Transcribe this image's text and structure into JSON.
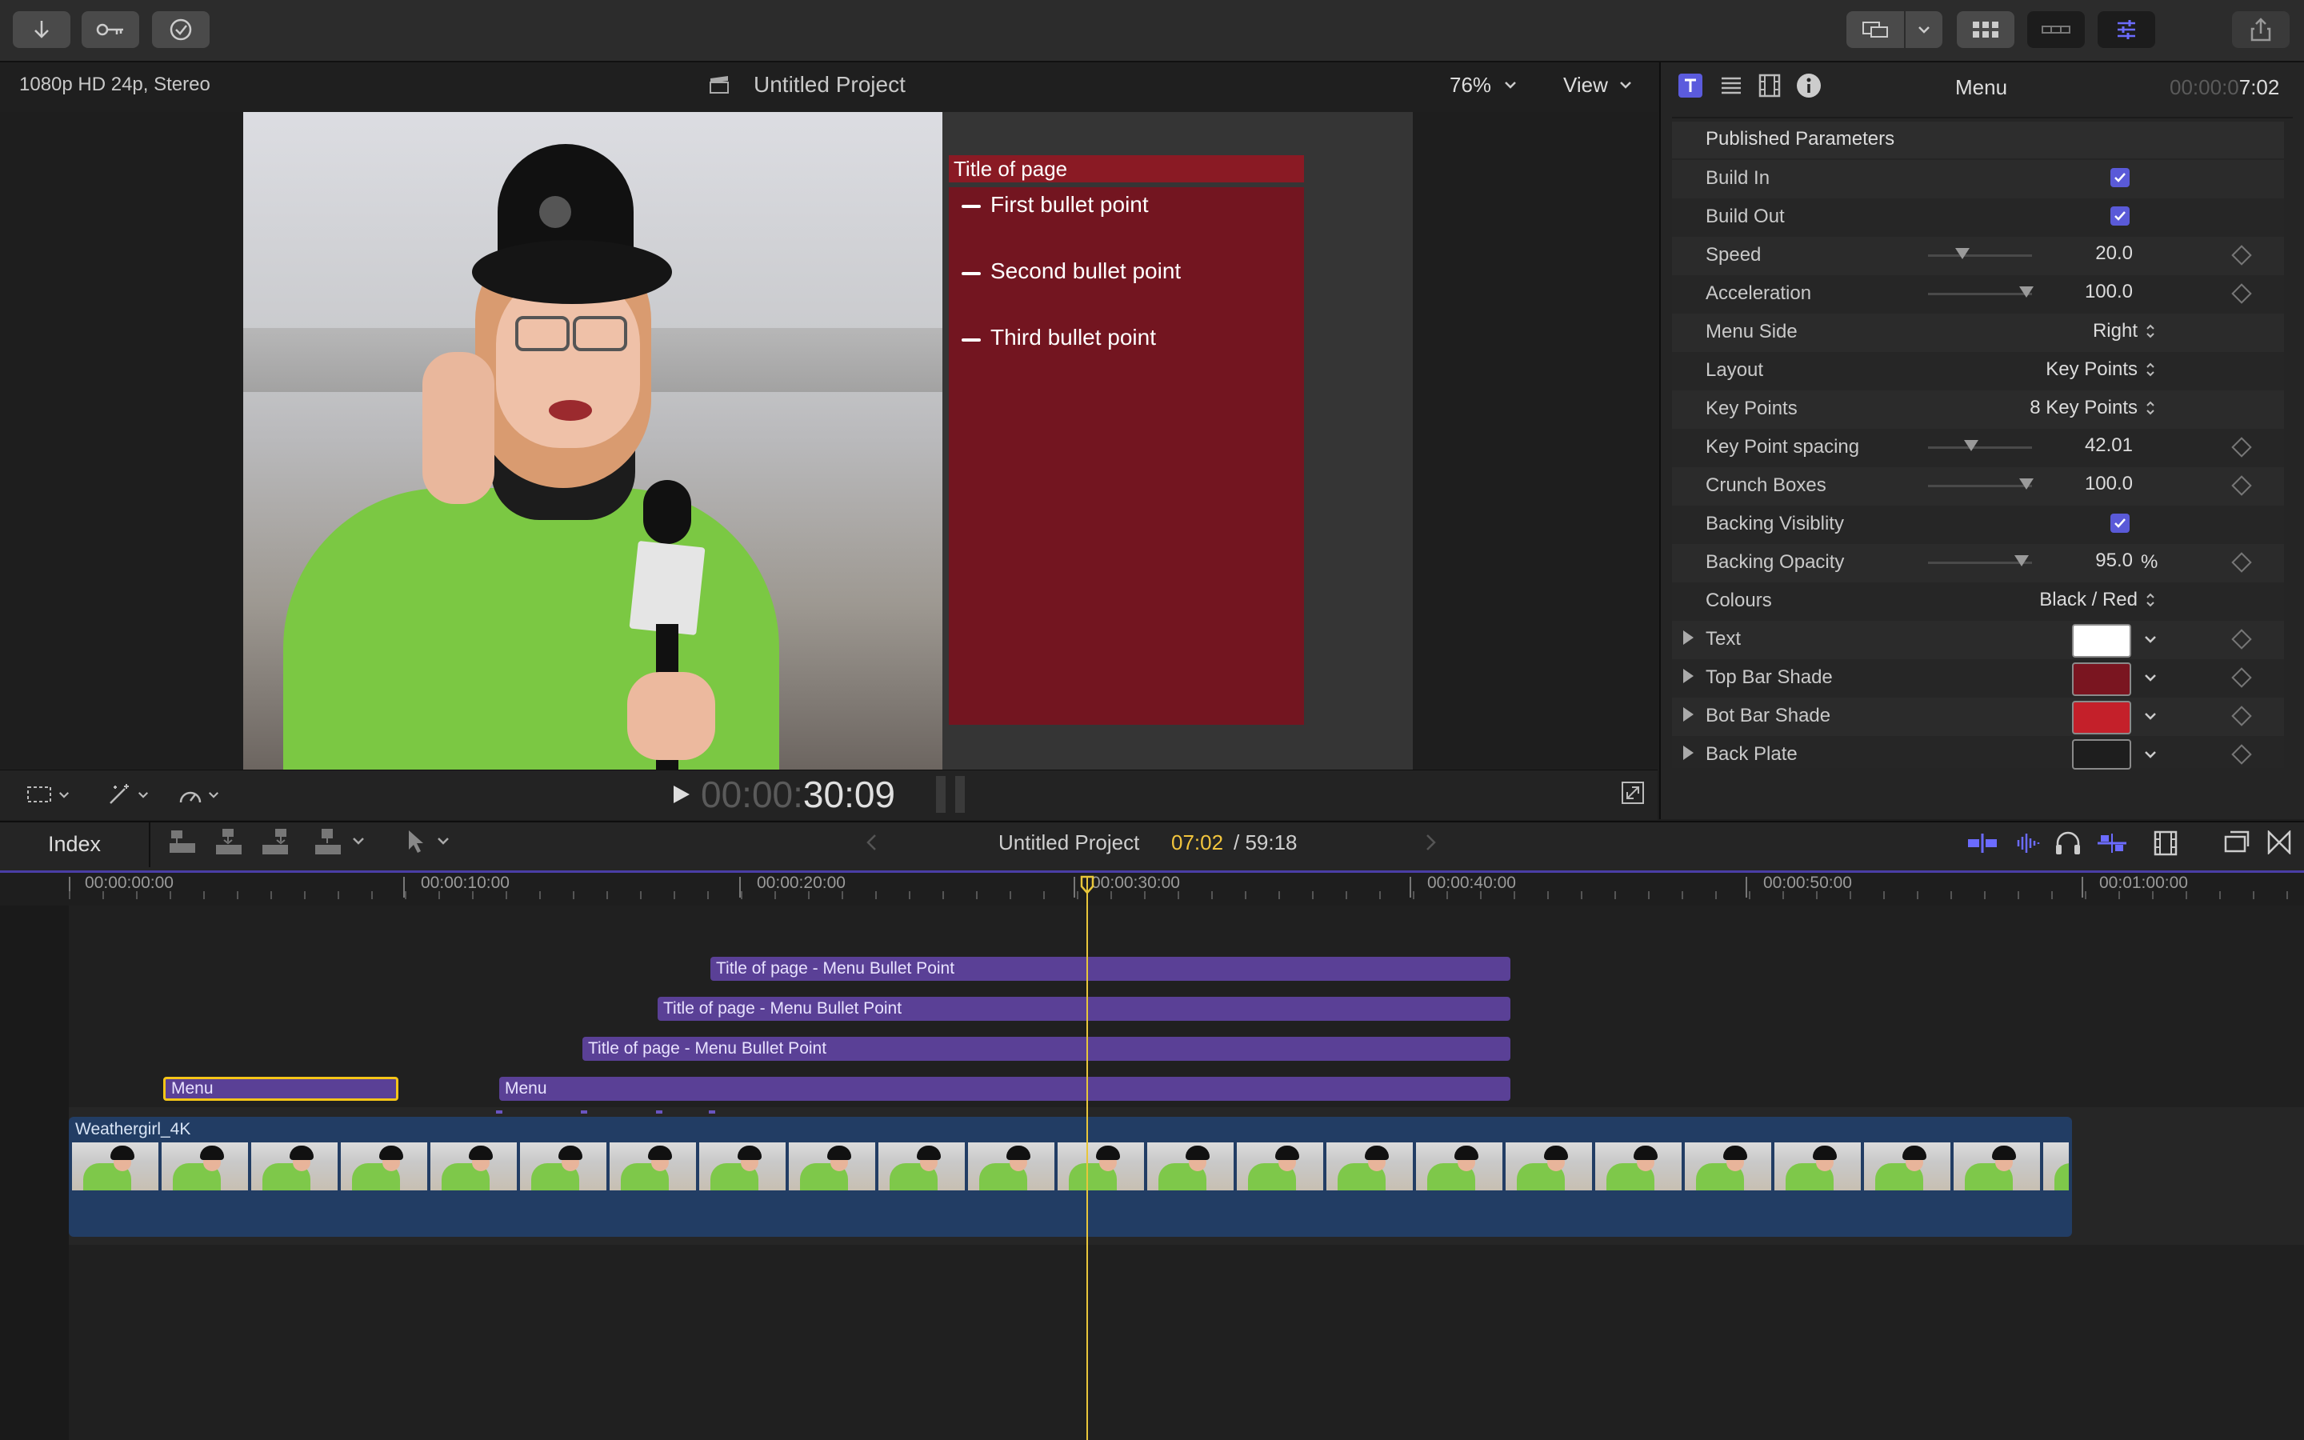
{
  "toolbar": {
    "import_icon": "down-arrow-icon",
    "keyword_icon": "key-icon",
    "analyze_icon": "checkmark-circle-icon",
    "share_icon": "share-icon"
  },
  "viewer": {
    "format": "1080p HD 24p, Stereo",
    "project_title": "Untitled Project",
    "zoom": "76%",
    "view_label": "View",
    "title_overlay": {
      "title": "Title of page",
      "bullets": [
        "First bullet point",
        "Second bullet point",
        "Third bullet point"
      ]
    },
    "timecode_dim": "00:00:",
    "timecode_bright": "30:09"
  },
  "inspector": {
    "title": "Menu",
    "timecode_dim": "00:00:0",
    "timecode_bright": "7:02",
    "section_title": "Published Parameters",
    "params": {
      "build_in": {
        "label": "Build In",
        "checked": true
      },
      "build_out": {
        "label": "Build Out",
        "checked": true
      },
      "speed": {
        "label": "Speed",
        "value": "20.0",
        "level": 0.2
      },
      "acceleration": {
        "label": "Acceleration",
        "value": "100.0",
        "level": 1.0
      },
      "menu_side": {
        "label": "Menu Side",
        "value": "Right"
      },
      "layout": {
        "label": "Layout",
        "value": "Key Points"
      },
      "key_points": {
        "label": "Key Points",
        "value": "8 Key Points"
      },
      "key_point_spacing": {
        "label": "Key Point spacing",
        "value": "42.01",
        "level": 0.42
      },
      "crunch_boxes": {
        "label": "Crunch Boxes",
        "value": "100.0",
        "level": 1.0
      },
      "backing_visibility": {
        "label": "Backing Visiblity",
        "checked": true
      },
      "backing_opacity": {
        "label": "Backing Opacity",
        "value": "95.0",
        "unit": "%",
        "level": 0.95
      },
      "colours": {
        "label": "Colours",
        "value": "Black / Red"
      },
      "text": {
        "label": "Text",
        "color": "#ffffff"
      },
      "top_bar_shade": {
        "label": "Top Bar Shade",
        "color": "#7a1520"
      },
      "bot_bar_shade": {
        "label": "Bot Bar Shade",
        "color": "#c4202a"
      },
      "back_plate": {
        "label": "Back Plate",
        "color": "#1e1e1e"
      }
    }
  },
  "timeline": {
    "index_label": "Index",
    "project_title": "Untitled Project",
    "current_time": "07:02",
    "total_time": "/ 59:18",
    "ruler": [
      "00:00:00:00",
      "00:00:10:00",
      "00:00:20:00",
      "00:00:30:00",
      "00:00:40:00",
      "00:00:50:00",
      "00:01:00:00"
    ],
    "clips": {
      "title1": "Title of page - Menu Bullet Point",
      "title2": "Title of page - Menu Bullet Point",
      "title3": "Title of page - Menu Bullet Point",
      "menu_selected": "Menu",
      "menu2": "Menu",
      "video": "Weathergirl_4K"
    }
  }
}
